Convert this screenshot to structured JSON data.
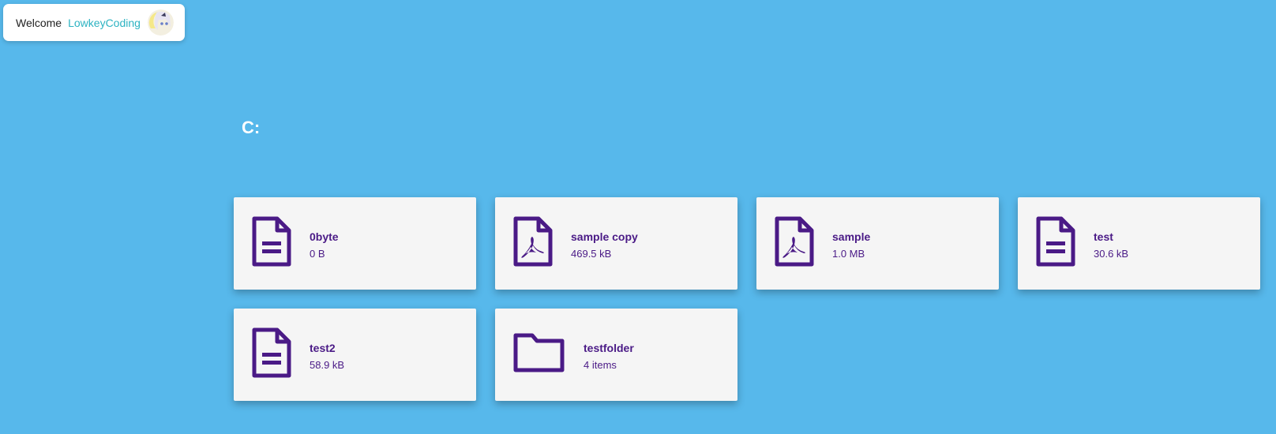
{
  "header": {
    "welcome": "Welcome",
    "username": "LowkeyCoding"
  },
  "drive": {
    "title": "C:"
  },
  "items": [
    {
      "name": "0byte",
      "size": "0 B",
      "icon": "file-text-icon"
    },
    {
      "name": "sample copy",
      "size": "469.5 kB",
      "icon": "pdf-file-icon"
    },
    {
      "name": "sample",
      "size": "1.0 MB",
      "icon": "pdf-file-icon"
    },
    {
      "name": "test",
      "size": "30.6 kB",
      "icon": "file-text-icon"
    },
    {
      "name": "test2",
      "size": "58.9 kB",
      "icon": "file-text-icon"
    },
    {
      "name": "testfolder",
      "size": "4 items",
      "icon": "folder-icon"
    }
  ],
  "colors": {
    "background": "#57b8eb",
    "card": "#f5f5f5",
    "accent": "#4a1a86",
    "username": "#2db3c2"
  }
}
